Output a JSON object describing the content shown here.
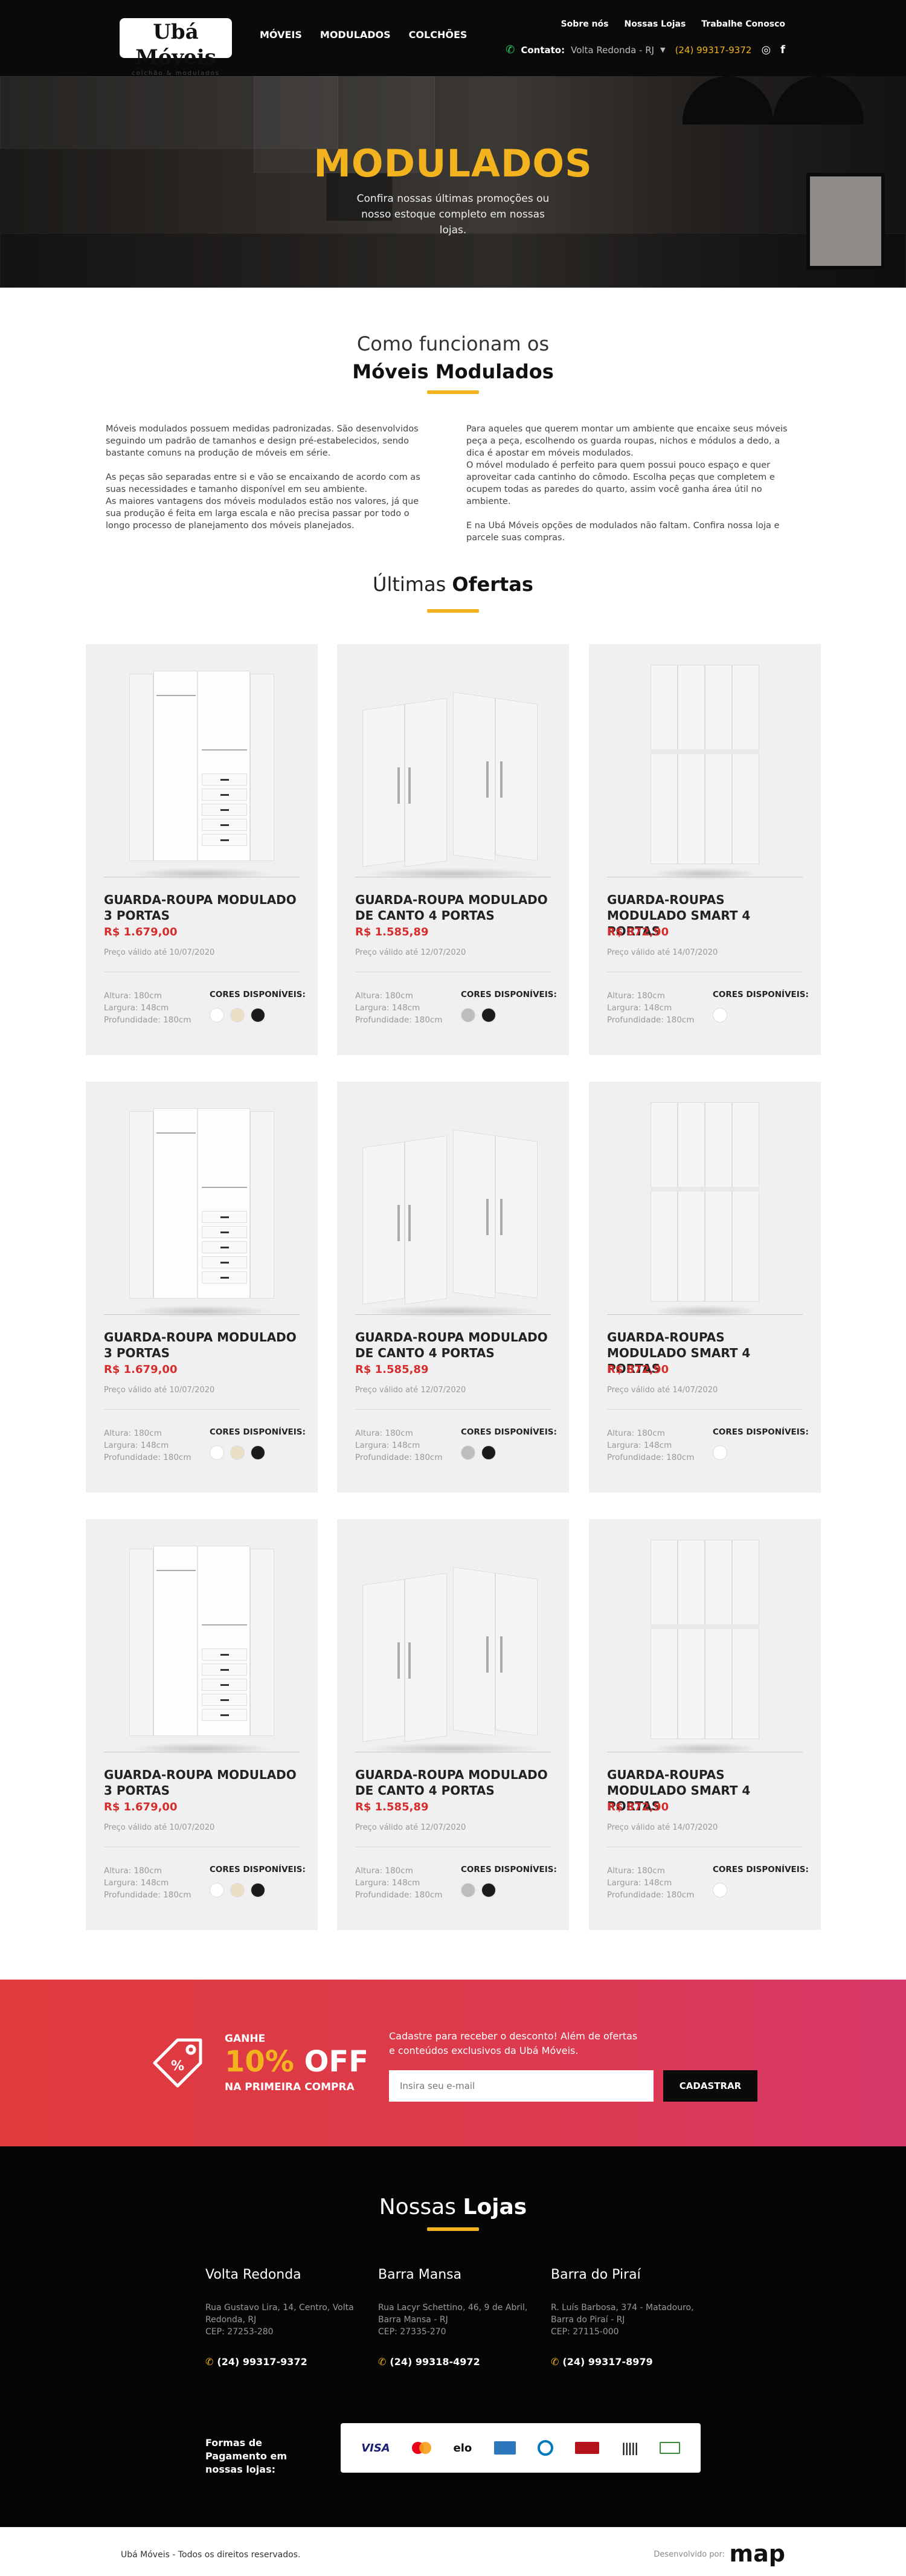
{
  "header": {
    "logo_main": "Ubá Móveis",
    "logo_sub": "colchão & modulados",
    "main_nav": [
      "MÓVEIS",
      "MODULADOS",
      "COLCHÕES"
    ],
    "top_nav": [
      "Sobre nós",
      "Nossas Lojas",
      "Trabalhe Conosco"
    ],
    "contact_label": "Contato:",
    "contact_city": "Volta Redonda - RJ",
    "contact_phone": "(24) 99317-9372"
  },
  "hero": {
    "title": "MODULADOS",
    "subtitle": "Confira nossas últimas promoções ou nosso estoque completo em nossas lojas."
  },
  "how": {
    "title_a": "Como funcionam os",
    "title_b": "Móveis Modulados",
    "left": [
      "Móveis modulados possuem medidas padronizadas. São desenvolvidos seguindo um padrão de tamanhos e design pré-estabelecidos, sendo bastante comuns na produção de móveis em série.",
      "As peças são separadas entre si e vão se encaixando de acordo com as suas necessidades e tamanho disponível em seu ambiente.",
      "As maiores vantagens dos móveis modulados estão nos valores, já que sua produção é feita em larga escala e não precisa passar por todo o longo processo de planejamento dos móveis planejados."
    ],
    "right": [
      "Para aqueles que querem montar um ambiente que encaixe seus móveis peça a peça, escolhendo os guarda roupas, nichos e módulos a dedo, a dica é apostar em móveis modulados.",
      "O móvel modulado é perfeito para quem possui pouco espaço e quer aproveitar cada cantinho do cômodo. Escolha peças que completem e ocupem todas as paredes do quarto, assim você ganha área útil no ambiente.",
      "E na Ubá Móveis opções de modulados não faltam. Confira nossa loja e parcele suas compras."
    ]
  },
  "offers": {
    "title_a": "Últimas",
    "title_b": "Ofertas",
    "colors_label": "CORES DISPONÍVEIS:",
    "products": [
      {
        "name": "GUARDA-ROUPA MODULADO 3 PORTAS",
        "price": "R$ 1.679,00",
        "valid": "Preço válido até 10/07/2020",
        "h": "Altura: 180cm",
        "w": "Largura: 148cm",
        "d": "Profundidade: 180cm",
        "kind": "open",
        "colors": [
          "#ffffff",
          "#e8dfc6",
          "#1b1b1b"
        ]
      },
      {
        "name": "GUARDA-ROUPA MODULADO DE CANTO 4 PORTAS",
        "price": "R$ 1.585,89",
        "valid": "Preço válido até 12/07/2020",
        "h": "Altura: 180cm",
        "w": "Largura: 148cm",
        "d": "Profundidade: 180cm",
        "kind": "corner",
        "colors": [
          "#bdbdbd",
          "#1b1b1b"
        ]
      },
      {
        "name": "GUARDA-ROUPAS MODULADO SMART 4 PORTAS",
        "price": "R$ 872,90",
        "valid": "Preço válido até 14/07/2020",
        "h": "Altura: 180cm",
        "w": "Largura: 148cm",
        "d": "Profundidade: 180cm",
        "kind": "smart",
        "colors": [
          "#ffffff"
        ]
      },
      {
        "name": "GUARDA-ROUPA MODULADO 3 PORTAS",
        "price": "R$ 1.679,00",
        "valid": "Preço válido até 10/07/2020",
        "h": "Altura: 180cm",
        "w": "Largura: 148cm",
        "d": "Profundidade: 180cm",
        "kind": "open",
        "colors": [
          "#ffffff",
          "#e8dfc6",
          "#1b1b1b"
        ]
      },
      {
        "name": "GUARDA-ROUPA MODULADO DE CANTO 4 PORTAS",
        "price": "R$ 1.585,89",
        "valid": "Preço válido até 12/07/2020",
        "h": "Altura: 180cm",
        "w": "Largura: 148cm",
        "d": "Profundidade: 180cm",
        "kind": "corner",
        "colors": [
          "#bdbdbd",
          "#1b1b1b"
        ]
      },
      {
        "name": "GUARDA-ROUPAS MODULADO SMART 4 PORTAS",
        "price": "R$ 872,90",
        "valid": "Preço válido até 14/07/2020",
        "h": "Altura: 180cm",
        "w": "Largura: 148cm",
        "d": "Profundidade: 180cm",
        "kind": "smart",
        "colors": [
          "#ffffff"
        ]
      },
      {
        "name": "GUARDA-ROUPA MODULADO 3 PORTAS",
        "price": "R$ 1.679,00",
        "valid": "Preço válido até 10/07/2020",
        "h": "Altura: 180cm",
        "w": "Largura: 148cm",
        "d": "Profundidade: 180cm",
        "kind": "open",
        "colors": [
          "#ffffff",
          "#e8dfc6",
          "#1b1b1b"
        ]
      },
      {
        "name": "GUARDA-ROUPA MODULADO DE CANTO 4 PORTAS",
        "price": "R$ 1.585,89",
        "valid": "Preço válido até 12/07/2020",
        "h": "Altura: 180cm",
        "w": "Largura: 148cm",
        "d": "Profundidade: 180cm",
        "kind": "corner",
        "colors": [
          "#bdbdbd",
          "#1b1b1b"
        ]
      },
      {
        "name": "GUARDA-ROUPAS MODULADO SMART 4 PORTAS",
        "price": "R$ 872,90",
        "valid": "Preço válido até 14/07/2020",
        "h": "Altura: 180cm",
        "w": "Largura: 148cm",
        "d": "Profundidade: 180cm",
        "kind": "smart",
        "colors": [
          "#ffffff"
        ]
      }
    ]
  },
  "newsletter": {
    "ganhe": "GANHE",
    "off_pct": "10%",
    "off_word": "OFF",
    "first": "NA PRIMEIRA COMPRA",
    "desc": "Cadastre para receber o desconto! Além de ofertas e conteúdos exclusivos da Ubá Móveis.",
    "placeholder": "Insira seu e-mail",
    "button": "CADASTRAR"
  },
  "stores": {
    "title_a": "Nossas",
    "title_b": "Lojas",
    "list": [
      {
        "name": "Volta Redonda",
        "addr1": "Rua Gustavo Lira, 14, Centro, Volta Redonda, RJ",
        "addr2": "CEP: 27253-280",
        "phone": "(24) 99317-9372"
      },
      {
        "name": "Barra Mansa",
        "addr1": "Rua Lacyr Schettino, 46, 9 de Abril, Barra Mansa - RJ",
        "addr2": "CEP: 27335-270",
        "phone": "(24) 99318-4972"
      },
      {
        "name": "Barra do Piraí",
        "addr1": "R. Luís Barbosa, 374 - Matadouro, Barra do Piraí - RJ",
        "addr2": "CEP: 27115-000",
        "phone": "(24) 99317-8979"
      }
    ],
    "pay_label": "Formas de Pagamento em nossas lojas:",
    "pay_methods": [
      "VISA",
      "mastercard",
      "elo",
      "amex",
      "diners",
      "hipercard",
      "boleto",
      "dinheiro"
    ]
  },
  "footer": {
    "copyright": "Ubá Móveis - Todos os direitos reservados.",
    "dev_label": "Desenvolvido por:",
    "dev_logo": "map"
  }
}
